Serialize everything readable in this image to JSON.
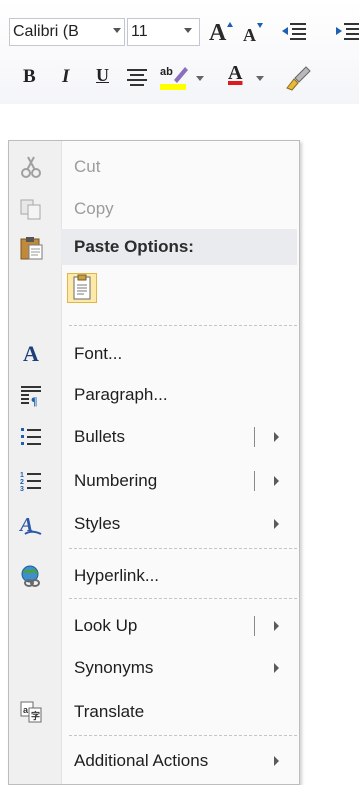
{
  "mini_toolbar": {
    "font_name": "Calibri (B",
    "font_size": "11",
    "grow_font_glyph": "A",
    "shrink_font_glyph": "A",
    "bold_glyph": "B",
    "italic_glyph": "I",
    "underline_glyph": "U",
    "font_color_glyph": "A",
    "highlight_color": "#ffff00",
    "font_color": "#e0191e"
  },
  "context_menu": {
    "cut": "Cut",
    "copy": "Copy",
    "paste_options_header": "Paste Options:",
    "font": "Font...",
    "paragraph": "Paragraph...",
    "bullets": "Bullets",
    "numbering": "Numbering",
    "styles": "Styles",
    "hyperlink": "Hyperlink...",
    "look_up": "Look Up",
    "synonyms": "Synonyms",
    "translate": "Translate",
    "additional_actions": "Additional Actions",
    "font_icon_glyph": "A"
  }
}
